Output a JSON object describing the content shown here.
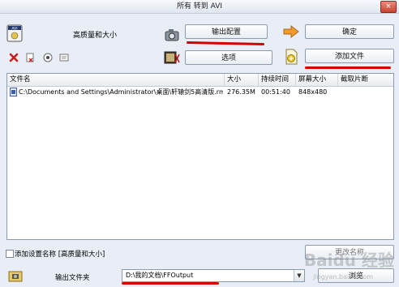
{
  "window": {
    "title": "所有 转到 AVI",
    "close_glyph": "×"
  },
  "top": {
    "quality_label": "高质量和大小",
    "output_config_button": "输出配置",
    "ok_button": "确定",
    "options_button": "选项",
    "add_file_button": "添加文件"
  },
  "list": {
    "columns": [
      "文件名",
      "大小",
      "持续时间",
      "屏幕大小",
      "截取片断"
    ],
    "rows": [
      {
        "filename": "C:\\Documents and Settings\\Administrator\\桌面\\轩辕剑5高清版.rmvb",
        "size": "276.35M",
        "duration": "00:51:40",
        "screen": "848x480",
        "clip": ""
      }
    ]
  },
  "bottom": {
    "add_setting_label": "添加设置名称 [高质量和大小]",
    "output_folder_label": "输出文件夹",
    "output_path": "D:\\我的文档\\FFOutput",
    "browse_button": "浏览",
    "hidden_button": "更改名称"
  },
  "watermark": {
    "text": "Baidu 经验",
    "sub": "jingyan.baidu.com"
  },
  "colors": {
    "annotation_red": "#d40000",
    "window_bg": "#e9eef6"
  }
}
